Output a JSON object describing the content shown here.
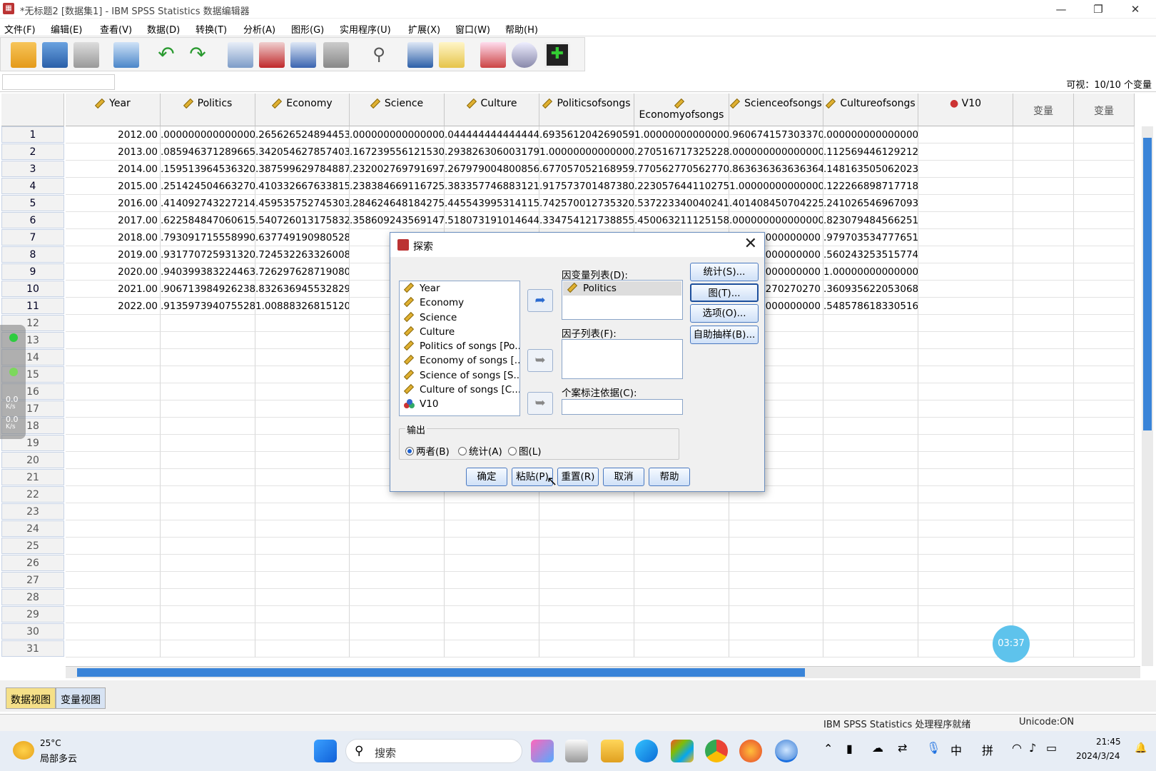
{
  "window": {
    "title": "*无标题2 [数据集1] - IBM SPSS Statistics 数据编辑器"
  },
  "menu": [
    "文件(F)",
    "编辑(E)",
    "查看(V)",
    "数据(D)",
    "转换(T)",
    "分析(A)",
    "图形(G)",
    "实用程序(U)",
    "扩展(X)",
    "窗口(W)",
    "帮助(H)"
  ],
  "cellbar": {
    "visible": "可视：10/10 个变量"
  },
  "grid": {
    "columns": [
      "Year",
      "Politics",
      "Economy",
      "Science",
      "Culture",
      "Politicsofsongs",
      "Economyofsongs",
      "Scienceofsongs",
      "Cultureofsongs",
      "V10",
      "变量",
      "变量"
    ],
    "row_numbers": [
      "1",
      "2",
      "3",
      "4",
      "5",
      "6",
      "7",
      "8",
      "9",
      "10",
      "11",
      "12",
      "13",
      "14",
      "15",
      "16",
      "17",
      "18",
      "19",
      "20",
      "21",
      "22",
      "23",
      "24",
      "25",
      "26",
      "27",
      "28",
      "29",
      "30",
      "31"
    ],
    "rows": [
      [
        "2012.00",
        ".000000000000000",
        ".265626524894453",
        ".000000000000000",
        ".044444444444444",
        ".693561204269059",
        "1.00000000000000",
        ".960674157303370",
        ".000000000000000"
      ],
      [
        "2013.00",
        ".085946371289665",
        ".342054627857403",
        ".167239556121530",
        ".293826306003179",
        "1.00000000000000",
        ".270516717325228",
        ".000000000000000",
        ".112569446129212"
      ],
      [
        "2014.00",
        ".159513964536320",
        ".387599629784887",
        ".232002769791697",
        ".267979004800856",
        ".677057052168959",
        ".770562770562770",
        ".863636363636364",
        ".148163505062023"
      ],
      [
        "2015.00",
        ".251424504663270",
        ".410332667633815",
        ".238384669116725",
        ".383357746883121",
        ".917573701487380",
        ".223057644110275",
        "1.00000000000000",
        ".122266898717718"
      ],
      [
        "2016.00",
        ".414092743227214",
        ".459535752745303",
        ".284624648184275",
        ".445543995314115",
        ".742570012735320",
        ".537223340040241",
        ".401408450704225",
        ".241026546967093"
      ],
      [
        "2017.00",
        ".622584847060615",
        ".540726013175832",
        ".358609243569147",
        ".518073191014644",
        ".334754121738855",
        ".450063211125158",
        ".000000000000000",
        ".823079484566251"
      ],
      [
        "2018.00",
        ".793091715558990",
        ".637749190980528",
        ".457951",
        "",
        "",
        "",
        "0000000000",
        ".979703534777651"
      ],
      [
        "2019.00",
        ".931770725931320",
        ".724532263326008",
        ".546285",
        "",
        "",
        "",
        "0000000000",
        ".560243253515774"
      ],
      [
        "2020.00",
        ".940399383224463",
        ".726297628719080",
        ".657677",
        "",
        "",
        "",
        "0000000000",
        "1.00000000000000"
      ],
      [
        "2021.00",
        ".906713984926238",
        ".832636945532829",
        ".823716",
        "",
        "",
        "",
        "0270270270",
        ".360935622053068"
      ],
      [
        "2022.00",
        ".913597394075528",
        "1.00888326815120",
        "1.00000",
        "",
        "",
        "",
        "0000000000",
        ".548578618330516"
      ]
    ]
  },
  "dialog": {
    "title": "探索",
    "source_vars": [
      "Year",
      "Economy",
      "Science",
      "Culture",
      "Politics of songs [Po...",
      "Economy of songs [...",
      "Science of songs [S...",
      "Culture of songs [C...",
      "V10"
    ],
    "dependent_label": "因变量列表(D):",
    "dependent_vars": [
      "Politics"
    ],
    "factor_label": "因子列表(F):",
    "case_label": "个案标注依据(C):",
    "side_buttons": [
      "统计(S)...",
      "图(T)...",
      "选项(O)...",
      "自助抽样(B)..."
    ],
    "output_label": "输出",
    "output_options": [
      "两者(B)",
      "统计(A)",
      "图(L)"
    ],
    "output_selected": "两者(B)",
    "bottom_buttons": [
      "确定",
      "粘贴(P)",
      "重置(R)",
      "取消",
      "帮助"
    ]
  },
  "tabs": [
    "数据视图",
    "变量视图"
  ],
  "status": {
    "processor": "IBM SPSS Statistics 处理程序就绪",
    "unicode": "Unicode:ON"
  },
  "overlay": {
    "timer": "03:37",
    "net1": "0.0",
    "net2": "0.0",
    "unit": "K/s"
  },
  "taskbar": {
    "weather_temp": "25°C",
    "weather_desc": "局部多云",
    "search_placeholder": "搜索",
    "ime1": "中",
    "ime2": "拼",
    "time": "21:45",
    "date": "2024/3/24"
  },
  "colors": {
    "accent": "#3a84d8",
    "dialog_border": "#6b8fbf",
    "timer": "#5ec3ec"
  }
}
